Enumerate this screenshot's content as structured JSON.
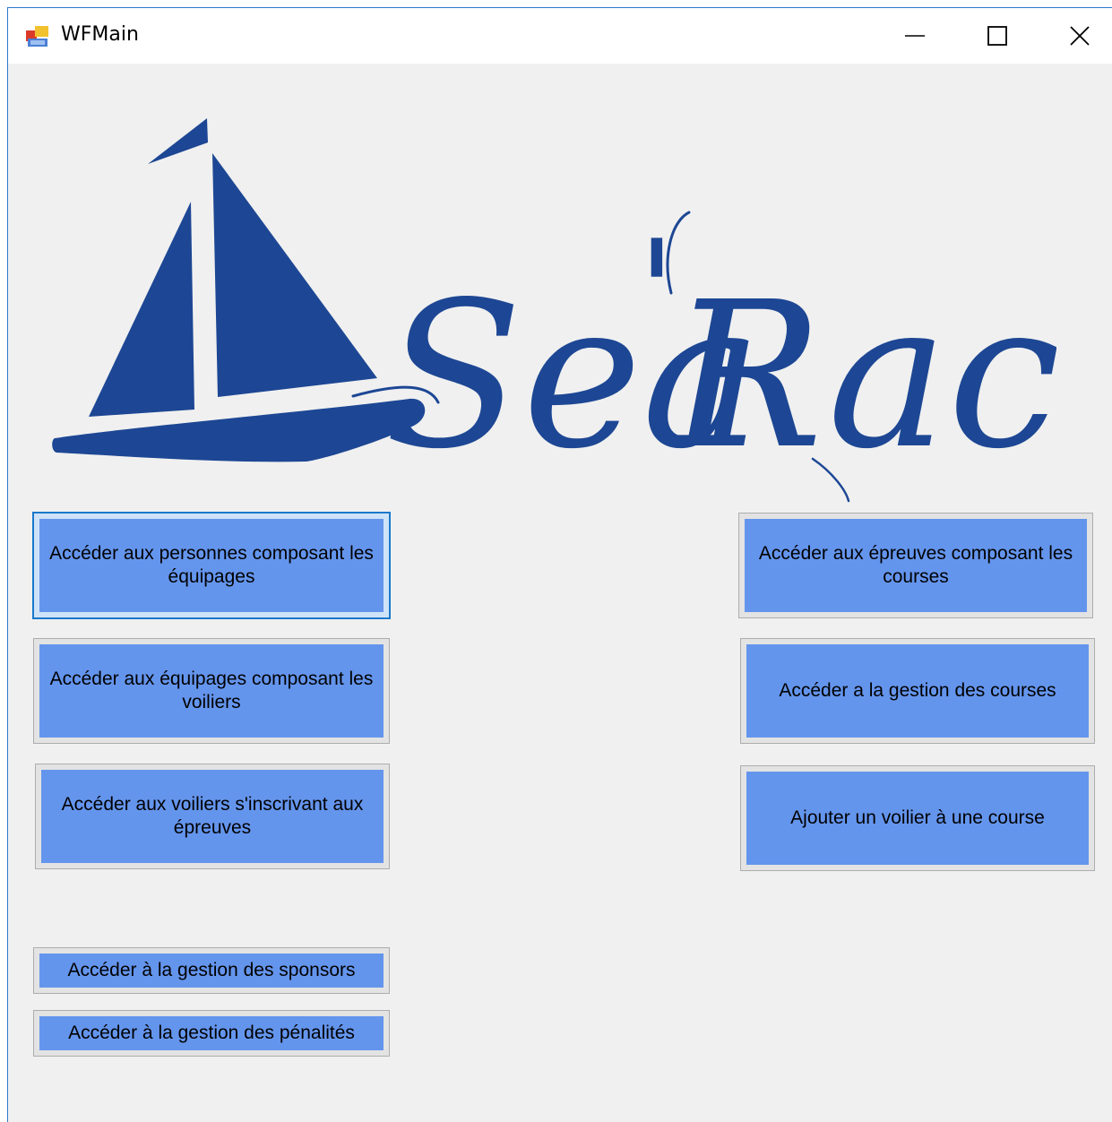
{
  "window": {
    "title": "WFMain",
    "controls": {
      "minimize": "minimize-icon",
      "maximize": "maximize-icon",
      "close": "close-icon"
    }
  },
  "logo": {
    "text_sea": "Sea",
    "text_apostrophe": "'",
    "text_race": "Race",
    "color": "#1d4794"
  },
  "buttons": {
    "personnes": "Accéder aux personnes composant les équipages",
    "equipages": "Accéder aux équipages composant les voiliers",
    "voiliers": "Accéder aux voiliers s'inscrivant aux épreuves",
    "sponsors": "Accéder à la gestion des sponsors",
    "penalites": "Accéder à la gestion des pénalités",
    "epreuves": "Accéder aux épreuves composant les courses",
    "courses": "Accéder a la gestion des courses",
    "ajouter": "Ajouter un voilier à une course"
  },
  "colors": {
    "button": "#6495ed",
    "window_bg": "#f0f0f0",
    "title_border": "#2b79d0"
  }
}
